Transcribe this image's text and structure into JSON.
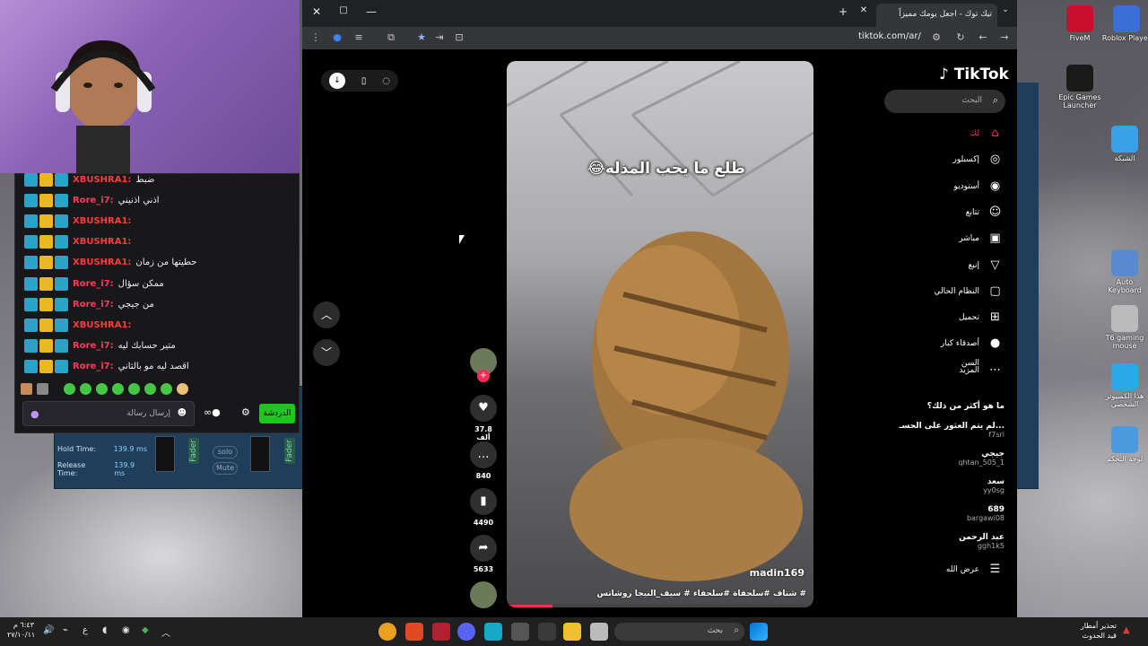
{
  "chat": {
    "lines": [
      {
        "user": "XBUSHRA1:",
        "color": "#ff3b3b",
        "msg": "ضبط"
      },
      {
        "user": "Rore_i7:",
        "color": "#ff3b5c",
        "msg": "اذني اذنيني"
      },
      {
        "user": "XBUSHRA1:",
        "color": "#ff3b3b",
        "msg": ""
      },
      {
        "user": "XBUSHRA1:",
        "color": "#ff3b3b",
        "msg": ""
      },
      {
        "user": "XBUSHRA1:",
        "color": "#ff3b3b",
        "msg": "حطيتها من زمان"
      },
      {
        "user": "Rore_i7:",
        "color": "#ff3b5c",
        "msg": "ممكن سؤال"
      },
      {
        "user": "Rore_i7:",
        "color": "#ff3b5c",
        "msg": "من جيجي"
      },
      {
        "user": "XBUSHRA1:",
        "color": "#ff3b3b",
        "msg": ""
      },
      {
        "user": "Rore_i7:",
        "color": "#ff3b5c",
        "msg": "متير حسابك ليه"
      },
      {
        "user": "Rore_i7:",
        "color": "#ff3b5c",
        "msg": "اقصد ليه مو بالثاني"
      }
    ],
    "input_placeholder": "إرسال رسالة",
    "send_label": "الدردشة"
  },
  "plugin": {
    "hold_label": "Hold Time:",
    "hold_value": "139.9 ms",
    "release_label": "Release Time:",
    "release_value": "139.9 ms",
    "fader_label": "Fader",
    "solo_label": "solo",
    "mute_label": "Mute"
  },
  "browser": {
    "tab_title": "تيك توك - اجعل يومك مميزاً",
    "url": "tiktok.com/ar/"
  },
  "tiktok": {
    "logo": "TikTok",
    "search_placeholder": "البحث",
    "nav": [
      {
        "label": "لك",
        "icon": "home-icon",
        "glyph": "⌂",
        "active": true
      },
      {
        "label": "إكسبلور",
        "icon": "compass-icon",
        "glyph": "◎",
        "active": false
      },
      {
        "label": "أستوديو",
        "icon": "studio-icon",
        "glyph": "◉",
        "active": false
      },
      {
        "label": "تتابع",
        "icon": "users-icon",
        "glyph": "☺",
        "active": false
      },
      {
        "label": "مباشر",
        "icon": "live-icon",
        "glyph": "▣",
        "active": false
      },
      {
        "label": "إنبع",
        "icon": "send-icon",
        "glyph": "▽",
        "active": false
      },
      {
        "label": "النظام الحالي",
        "icon": "message-icon",
        "glyph": "▢",
        "active": false
      },
      {
        "label": "تحميل",
        "icon": "upload-icon",
        "glyph": "⊞",
        "active": false
      },
      {
        "label": "أصدقاء كبار السن",
        "icon": "profile-icon",
        "glyph": "●",
        "active": false
      },
      {
        "label": "المزيد",
        "icon": "more-icon",
        "glyph": "⋯",
        "active": false
      }
    ],
    "suggest_title": "ما هو أكثر من ذلك؟",
    "suggestions": [
      {
        "name": "لم يتم العثور على الحسـ...",
        "handle": "f7sri"
      },
      {
        "name": "جيجي",
        "handle": "qhtan_505_1"
      },
      {
        "name": "سعد",
        "handle": "yy0sg"
      },
      {
        "name": "689",
        "handle": "bargawi08"
      },
      {
        "name": "عبد الرحمن",
        "handle": "ggh1k5"
      }
    ],
    "show_more": "عرض الله",
    "video": {
      "caption": "طلع ما يحب المذله😂",
      "author": "madin169",
      "tags": "# شتاف #سلحفاة #سلحفاء # سيف_النيجا روشاتس",
      "progress": 0.15
    },
    "actions": {
      "likes": "37.8 ألف",
      "comments": "840",
      "saves": "4490",
      "shares": "5633"
    }
  },
  "desktop": {
    "icons": [
      {
        "label": "FiveM",
        "color": "#c8102e"
      },
      {
        "label": "Roblox Player",
        "color": "#3b6fd8"
      },
      {
        "label": "Epic Games Launcher",
        "color": "#1a1a1a"
      },
      {
        "label": "الشبكة",
        "color": "#3aa0e8"
      },
      {
        "label": "Auto Keyboard",
        "color": "#5a8ad0"
      },
      {
        "label": "T6 gaming mouse",
        "color": "#bbbbbb"
      },
      {
        "label": "هذا الكمبيوتر الشخصي",
        "color": "#2aa8e8"
      },
      {
        "label": "لوحة التحكم",
        "color": "#4a9ae0"
      }
    ]
  },
  "taskbar": {
    "search_placeholder": "بحث",
    "time": "٦:٤٣ م",
    "date": "٢٧/١٠/١١",
    "weather_title": "تحذير أمطار",
    "weather_sub": "قيد الحدوث"
  }
}
